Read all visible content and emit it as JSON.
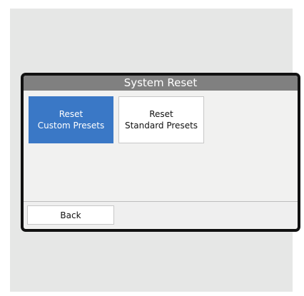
{
  "dialog": {
    "title": "System Reset"
  },
  "buttons": {
    "reset_custom": {
      "line1": "Reset",
      "line2": "Custom Presets"
    },
    "reset_standard": {
      "line1": "Reset",
      "line2": "Standard Presets"
    },
    "back": "Back"
  },
  "colors": {
    "title_bar": "#808080",
    "selected_button": "#3a78c6",
    "screen_background": "#f1f1f0",
    "bezel": "#111111"
  }
}
